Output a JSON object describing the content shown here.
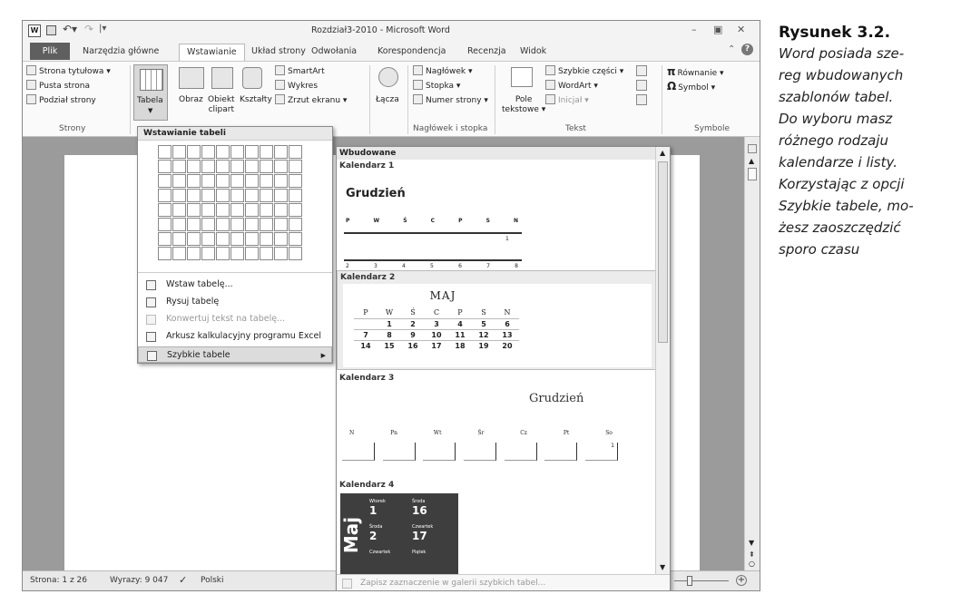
{
  "window": {
    "title": "Rozdział3-2010 - Microsoft Word"
  },
  "tabs": [
    "Plik",
    "Narzędzia główne",
    "Wstawianie",
    "Układ strony",
    "Odwołania",
    "Korespondencja",
    "Recenzja",
    "Widok"
  ],
  "ribbon": {
    "strony": {
      "items": [
        "Strona tytułowa ▾",
        "Pusta strona",
        "Podział strony"
      ],
      "group": "Strony"
    },
    "tabela": {
      "label": "Tabela"
    },
    "obraz": "Obraz",
    "obiekt": "Obiekt",
    "clipart": "clipart",
    "ksztalty": "Kształty",
    "smartart": "SmartArt",
    "wykres": "Wykres",
    "zrzut": "Zrzut ekranu ▾",
    "lacza": "Łącza",
    "naglowek": {
      "items": [
        "Nagłówek ▾",
        "Stopka ▾",
        "Numer strony ▾"
      ],
      "group": "Nagłówek i stopka"
    },
    "tekst": {
      "pole": "Pole",
      "tekstowe": "tekstowe ▾",
      "items": [
        "Szybkie części ▾",
        "WordArt ▾",
        "Inicjał ▾"
      ],
      "group": "Tekst"
    },
    "symbole": {
      "items": [
        "Równanie ▾",
        "Symbol ▾"
      ],
      "group": "Symbole"
    }
  },
  "table_menu": {
    "header": "Wstawianie tabeli",
    "items": [
      {
        "label": "Wstaw tabelę...",
        "disabled": false
      },
      {
        "label": "Rysuj tabelę",
        "disabled": false
      },
      {
        "label": "Konwertuj tekst na tabelę...",
        "disabled": true
      },
      {
        "label": "Arkusz kalkulacyjny programu Excel",
        "disabled": false
      },
      {
        "label": "Szybkie tabele",
        "disabled": false
      }
    ]
  },
  "quick_tables": {
    "header": "Wbudowane",
    "footer": "Zapisz zaznaczenie w galerii szybkich tabel...",
    "k1": {
      "name": "Kalendarz 1",
      "month": "Grudzień",
      "days": [
        "P",
        "W",
        "Ś",
        "C",
        "P",
        "S",
        "N"
      ],
      "row1": [
        "",
        "",
        "",
        "",
        "",
        "",
        "1"
      ],
      "row2": [
        "2",
        "3",
        "4",
        "5",
        "6",
        "7",
        "8"
      ]
    },
    "k2": {
      "name": "Kalendarz 2",
      "month": "MAJ",
      "days": [
        "P",
        "W",
        "Ś",
        "C",
        "P",
        "S",
        "N"
      ],
      "rows": [
        [
          "",
          "1",
          "2",
          "3",
          "4",
          "5",
          "6"
        ],
        [
          "7",
          "8",
          "9",
          "10",
          "11",
          "12",
          "13"
        ],
        [
          "14",
          "15",
          "16",
          "17",
          "18",
          "19",
          "20"
        ]
      ]
    },
    "k3": {
      "name": "Kalendarz 3",
      "month": "Grudzień",
      "days": [
        "N",
        "Pn",
        "Wt",
        "Śr",
        "Cz",
        "Pt",
        "So"
      ],
      "first": "1"
    },
    "k4": {
      "name": "Kalendarz 4",
      "month": "Maj",
      "cells": [
        {
          "day": "Wtorek",
          "num": "1"
        },
        {
          "day": "Środa",
          "num": "16"
        },
        {
          "day": "Środa",
          "num": "2"
        },
        {
          "day": "Czwartek",
          "num": "17"
        },
        {
          "day": "Czwartek",
          "num": ""
        },
        {
          "day": "Piątek",
          "num": ""
        }
      ]
    }
  },
  "status": {
    "page": "Strona: 1 z 26",
    "words": "Wyrazy: 9 047",
    "lang": "Polski"
  },
  "caption": {
    "title": "Rysunek 3.2.",
    "lines": [
      "Word posiada sze-",
      "reg wbudowanych",
      "szablonów tabel.",
      "Do wyboru masz",
      "różnego rodzaju",
      "kalendarze i listy.",
      "Korzystając z opcji",
      "Szybkie tabele, mo-",
      "żesz zaoszczędzić",
      "sporo czasu"
    ]
  }
}
